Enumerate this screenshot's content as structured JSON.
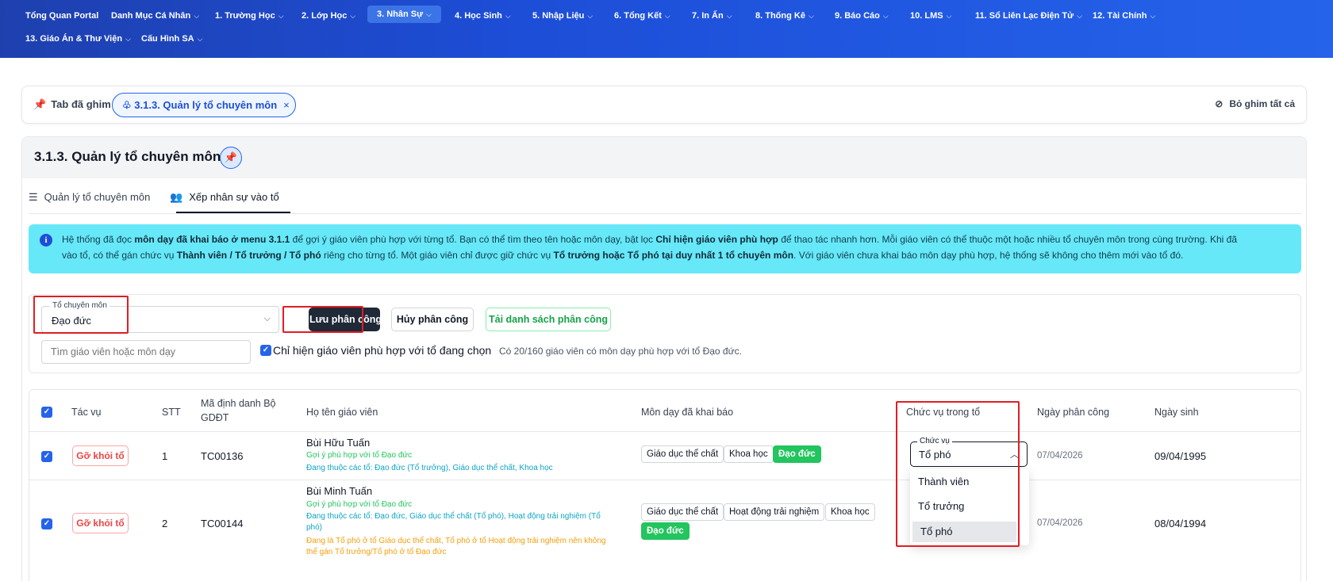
{
  "nav": {
    "items": [
      {
        "label": "Tổng Quan Portal",
        "chev": false
      },
      {
        "label": "Danh Mục Cá Nhân",
        "chev": true
      },
      {
        "label": "1. Trường Học",
        "chev": true
      },
      {
        "label": "2. Lớp Học",
        "chev": true
      },
      {
        "label": "3. Nhân Sự",
        "chev": true,
        "active": true
      },
      {
        "label": "4. Học Sinh",
        "chev": true
      },
      {
        "label": "5. Nhập Liệu",
        "chev": true
      },
      {
        "label": "6. Tổng Kết",
        "chev": true
      },
      {
        "label": "7. In Ấn",
        "chev": true
      },
      {
        "label": "8. Thống Kê",
        "chev": true
      },
      {
        "label": "9. Báo Cáo",
        "chev": true
      },
      {
        "label": "10. LMS",
        "chev": true
      },
      {
        "label": "11. Sổ Liên Lạc Điện Tử",
        "chev": true
      },
      {
        "label": "12. Tài Chính",
        "chev": true
      },
      {
        "label": "13. Giáo Án & Thư Viện",
        "chev": true
      },
      {
        "label": "Cấu Hình SA",
        "chev": true
      }
    ]
  },
  "pinbar": {
    "label": "Tab đã ghim",
    "chip": "3.1.3. Quản lý tổ chuyên môn",
    "unpin_all": "Bỏ ghim tất cả"
  },
  "page": {
    "title": "3.1.3. Quản lý tổ chuyên môn",
    "tabs": [
      "Quản lý tổ chuyên môn",
      "Xếp nhân sự vào tổ"
    ]
  },
  "alert": {
    "line1": [
      "Hệ thống đã đọc ",
      "môn dạy đã khai báo ở menu 3.1.1",
      " để gợi ý giáo viên phù hợp với từng tổ. Bạn có thể tìm theo tên hoặc môn dạy, bật lọc ",
      "Chỉ hiện giáo viên phù hợp",
      " để thao tác nhanh hơn. Mỗi giáo viên có thể thuộc một hoặc nhiều tổ chuyên môn trong cùng trường. Khi đã"
    ],
    "line2": [
      "vào tổ, có thể gán chức vụ ",
      "Thành viên / Tổ trưởng / Tổ phó",
      " riêng cho từng tổ. Một giáo viên chỉ được giữ chức vụ ",
      "Tổ trưởng hoặc Tổ phó tại duy nhất 1 tổ chuyên môn",
      ". Với giáo viên chưa khai báo môn dạy phù hợp, hệ thống sẽ không cho thêm mới vào tổ đó."
    ]
  },
  "filters": {
    "group_legend": "Tổ chuyên môn",
    "group_value": "Đạo đức",
    "save_button": "Lưu phân công",
    "cancel_button": "Hủy phân công",
    "download_button": "Tải danh sách phân công",
    "search_placeholder": "Tìm giáo viên hoặc môn dạy",
    "only_matching_label": "Chỉ hiện giáo viên phù hợp với tổ đang chọn",
    "match_note": "Có 20/160 giáo viên có môn dạy phù hợp với tổ Đạo đức."
  },
  "table": {
    "headers": {
      "action": "Tác vụ",
      "stt": "STT",
      "id_line1": "Mã định danh Bộ",
      "id_line2": "GDĐT",
      "name": "Họ tên giáo viên",
      "subjects": "Môn dạy đã khai báo",
      "role": "Chức vụ trong tổ",
      "assigned": "Ngày phân công",
      "dob": "Ngày sinh"
    },
    "remove_label": "Gỡ khỏi tổ",
    "rows": [
      {
        "stt": "1",
        "id": "TC00136",
        "name": "Bùi Hữu Tuấn",
        "hint": "Gợi ý phù hợp với tổ Đạo đức",
        "groups": "Đang thuộc các tổ: Đạo đức (Tổ trưởng), Giáo dục thể chất, Khoa học",
        "subjects": [
          "Giáo dục thể chất",
          "Khoa học",
          "Đạo đức"
        ],
        "assigned": "07/04/2026",
        "dob": "09/04/1995"
      },
      {
        "stt": "2",
        "id": "TC00144",
        "name": "Bùi Minh Tuấn",
        "hint": "Gợi ý phù hợp với tổ Đạo đức",
        "groups_line1": "Đang thuộc các tổ: Đạo đức, Giáo dục thể chất (Tổ phó), Hoạt động trải nghiệm (Tổ",
        "groups_line2": "phó)",
        "warn_line1": "Đang là Tổ phó ở tổ Giáo dục thể chất, Tổ phó ở tổ Hoạt động trải nghiệm nên không",
        "warn_line2": "thể gán Tổ trưởng/Tổ phó ở tổ Đạo đức",
        "subjects": [
          "Giáo dục thể chất",
          "Hoạt động trải nghiệm",
          "Khoa học",
          "Đạo đức"
        ],
        "assigned": "07/04/2026",
        "dob": "08/04/1994"
      }
    ],
    "role_select": {
      "legend": "Chức vụ",
      "value": "Tổ phó",
      "options": [
        "Thành viên",
        "Tổ trưởng",
        "Tổ phó"
      ]
    }
  }
}
